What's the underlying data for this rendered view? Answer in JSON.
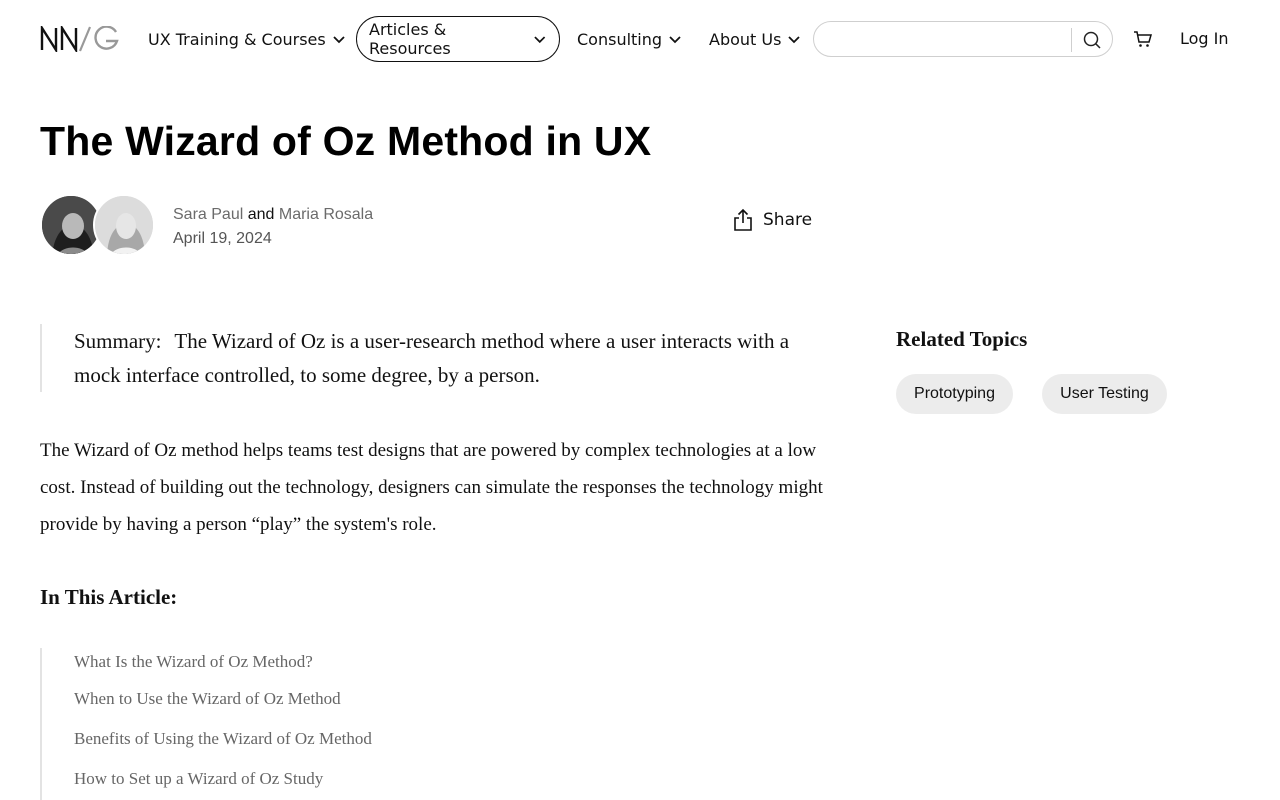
{
  "brand": {
    "logo_text": "NN/G"
  },
  "nav": {
    "items": [
      {
        "label": "UX Training & Courses"
      },
      {
        "label": "Articles & Resources"
      },
      {
        "label": "Consulting"
      },
      {
        "label": "About Us"
      }
    ],
    "active_index": 1,
    "search": {
      "value": "",
      "placeholder": ""
    },
    "login_label": "Log In"
  },
  "article": {
    "title": "The Wizard of Oz Method in UX",
    "authors": [
      "Sara Paul",
      "Maria Rosala"
    ],
    "author_conjunction": "and",
    "date": "April 19, 2024",
    "share_label": "Share",
    "summary_label": "Summary:",
    "summary_text": "The Wizard of Oz is a user-research method where a user interacts with a mock interface controlled, to some degree, by a person.",
    "intro": "The Wizard of Oz method helps teams test designs that are powered by complex technologies at a low cost. Instead of building out the technology, designers can simulate the responses the technology might provide by having a person “play” the system's role.",
    "toc_heading": "In This Article:",
    "toc": [
      "What Is the Wizard of Oz Method?",
      "When to Use the Wizard of Oz Method",
      "Benefits of Using the Wizard of Oz Method",
      "How to Set up a Wizard of Oz Study"
    ]
  },
  "related": {
    "heading": "Related Topics",
    "topics": [
      "Prototyping",
      "User Testing"
    ]
  },
  "icons": {
    "search": "search-icon",
    "cart": "cart-icon",
    "share": "share-icon",
    "chevron": "chevron-down-icon"
  }
}
